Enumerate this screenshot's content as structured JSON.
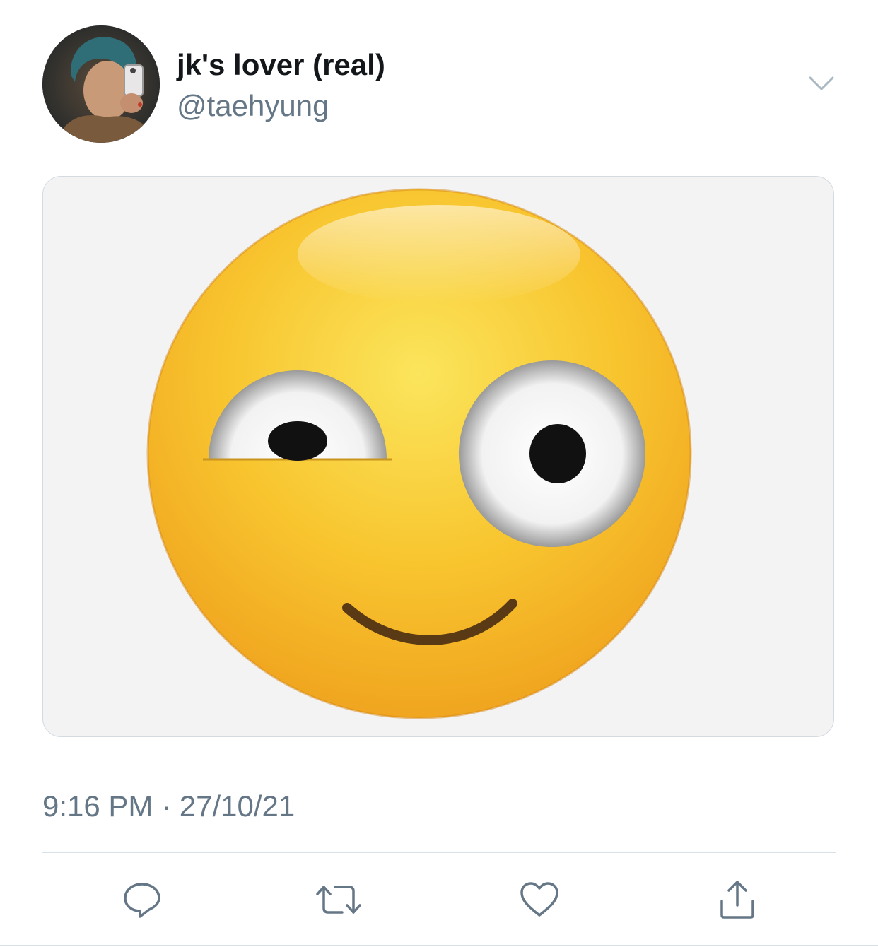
{
  "author": {
    "display_name": "jk's lover (real)",
    "handle": "@taehyung"
  },
  "tweet": {
    "timestamp": "9:16 PM · 27/10/21",
    "media": {
      "description_icon": "smirking-one-eye-wide-emoji"
    }
  },
  "icons": {
    "menu": "chevron-down-icon",
    "reply": "comment-icon",
    "retweet": "retweet-icon",
    "like": "heart-icon",
    "share": "share-icon"
  },
  "colors": {
    "text_primary": "#14171a",
    "text_secondary": "#657786",
    "icon_gray": "#657786",
    "divider": "#d9e1e8",
    "emoji_yellow": "#f7b928"
  }
}
